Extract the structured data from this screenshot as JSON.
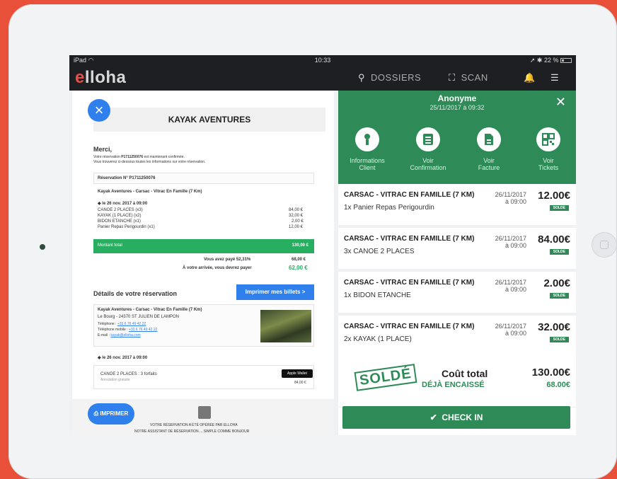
{
  "status": {
    "device": "iPad",
    "time": "10:33",
    "battery": "22 %"
  },
  "app": {
    "logo_e": "e",
    "logo_rest": "lloha",
    "nav_dossiers": "DOSSIERS",
    "nav_scan": "SCAN"
  },
  "left_doc": {
    "title": "KAYAK AVENTURES",
    "merci": "Merci,",
    "line1_a": "Votre réservation ",
    "line1_ref": "P1711250076",
    "line1_b": " est maintenant confirmée.",
    "line2": "Vous trouverez ci-dessous toutes les informations sur votre réservation.",
    "res_title": "Réservation N° P1711250076",
    "activity": "Kayak Aventures - Carsac - Vitrac En Famille (7 Km)",
    "date_line": "le 26 nov. 2017 à 09:00",
    "lines": [
      {
        "label": "CANOE 2 PLACES (x3)",
        "price": "84,00 €"
      },
      {
        "label": "KAYAK (1 PLACE) (x2)",
        "price": "32,00 €"
      },
      {
        "label": "BIDON ETANCHE (x1)",
        "price": "2,00 €"
      },
      {
        "label": "Panier Repas Perigourdin (x1)",
        "price": "12,00 €"
      }
    ],
    "montant_label": "Montant total",
    "montant_value": "130,00 €",
    "paid_label": "Vous avez payé 52,31%",
    "paid_value": "68,00 €",
    "due_label": "À votre arrivée, vous devrez payer",
    "due_value": "62,00 €",
    "details_title": "Détails de votre réservation",
    "print_tickets": "Imprimer mes billets >",
    "addr_title": "Kayak Aventures - Carsac - Vitrac En Famille (7 Km)",
    "addr1": "Le Bourg - 24370 ST JULIEN DE LAMPON",
    "tel_label": "Téléphone : ",
    "tel": "+33 6 76 49 42 22",
    "mob_label": "Téléphone mobile : ",
    "mob": "+33 6 76 49 42 22",
    "mail_label": "E-mail : ",
    "mail": "kayak@elloha.com",
    "date_line2": "le 26 nov. 2017 à 09:00",
    "canoe_line": "CANOE 2 PLACES : 3 forfaits",
    "canoe_sub": "Annulation gratuite",
    "canoe_price": "84,00 €",
    "apple_wallet": "Apple Wallet",
    "print_button": "IMPRIMER",
    "footer1": "VOTRE RÉSERVATION A ÉTÉ OPÉRÉE PAR ELLOHA",
    "footer2": "NOTRE ASSISTANT DE RÉSERVATION ... SIMPLE COMME BONJOUR"
  },
  "panel": {
    "name": "Anonyme",
    "date": "25/11/2017 à 09:32",
    "actions": [
      {
        "l1": "Informations",
        "l2": "Client"
      },
      {
        "l1": "Voir",
        "l2": "Confirmation"
      },
      {
        "l1": "Voir",
        "l2": "Facture"
      },
      {
        "l1": "Voir",
        "l2": "Tickets"
      }
    ],
    "items": [
      {
        "name": "CARSAC - VITRAC EN FAMILLE (7 KM)",
        "qty": "1x Panier Repas Perigourdin",
        "date": "26/11/2017",
        "time": "à 09:00",
        "price": "12.00€",
        "status": "SOLDE"
      },
      {
        "name": "CARSAC - VITRAC EN FAMILLE (7 KM)",
        "qty": "3x CANOE 2 PLACES",
        "date": "26/11/2017",
        "time": "à 09:00",
        "price": "84.00€",
        "status": "SOLDE"
      },
      {
        "name": "CARSAC - VITRAC EN FAMILLE (7 KM)",
        "qty": "1x BIDON ETANCHE",
        "date": "26/11/2017",
        "time": "à 09:00",
        "price": "2.00€",
        "status": "SOLDE"
      },
      {
        "name": "CARSAC - VITRAC EN FAMILLE (7 KM)",
        "qty": "2x KAYAK (1 PLACE)",
        "date": "26/11/2017",
        "time": "à 09:00",
        "price": "32.00€",
        "status": "SOLDE"
      }
    ],
    "stamp": "SOLDÉ",
    "total_label": "Coût total",
    "cashed_label": "DÉJÀ ENCAISSÉ",
    "total_value": "130.00€",
    "cashed_value": "68.00€",
    "checkin": "CHECK IN"
  },
  "colors": {
    "background": "#e8503a",
    "green": "#2e8b57",
    "blue": "#2f80ed"
  }
}
